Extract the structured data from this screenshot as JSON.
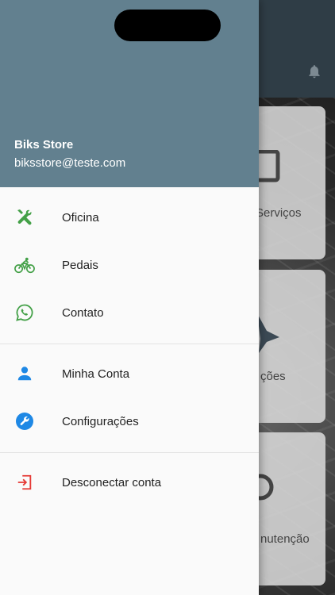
{
  "background": {
    "cards": [
      {
        "label": "Serviços"
      },
      {
        "label": "ções"
      },
      {
        "label": "nutenção"
      }
    ],
    "notification_icon": "bell-icon"
  },
  "drawer": {
    "header": {
      "name": "Biks Store",
      "email": "biksstore@teste.com",
      "color": "#62808f"
    },
    "items": [
      {
        "label": "Oficina",
        "icon": "tools-icon",
        "color": "#43a047"
      },
      {
        "label": "Pedais",
        "icon": "bicycle-icon",
        "color": "#43a047"
      },
      {
        "label": "Contato",
        "icon": "whatsapp-icon",
        "color": "#43a047"
      },
      {
        "label": "Minha Conta",
        "icon": "person-icon",
        "color": "#1e88e5"
      },
      {
        "label": "Configurações",
        "icon": "wrench-icon",
        "color": "#1e88e5"
      },
      {
        "label": "Desconectar conta",
        "icon": "logout-icon",
        "color": "#e53935"
      }
    ]
  }
}
